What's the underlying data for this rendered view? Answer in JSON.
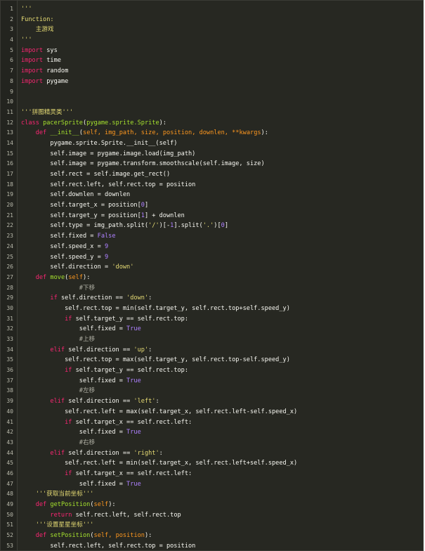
{
  "editor": {
    "colors": {
      "background": "#272822",
      "keyword": "#f92672",
      "function": "#a6e22e",
      "string": "#e6db74",
      "number": "#ae81ff",
      "parameter": "#fd971f",
      "text": "#f8f8f2"
    },
    "lines": [
      {
        "n": "1",
        "tokens": [
          [
            "str",
            "'''"
          ]
        ]
      },
      {
        "n": "2",
        "tokens": [
          [
            "str",
            "Function:"
          ]
        ]
      },
      {
        "n": "3",
        "tokens": [
          [
            "str",
            "    主游戏"
          ]
        ]
      },
      {
        "n": "4",
        "tokens": [
          [
            "str",
            "'''"
          ]
        ]
      },
      {
        "n": "5",
        "tokens": [
          [
            "kw",
            "import"
          ],
          [
            "txt",
            " sys"
          ]
        ]
      },
      {
        "n": "6",
        "tokens": [
          [
            "kw",
            "import"
          ],
          [
            "txt",
            " time"
          ]
        ]
      },
      {
        "n": "7",
        "tokens": [
          [
            "kw",
            "import"
          ],
          [
            "txt",
            " random"
          ]
        ]
      },
      {
        "n": "8",
        "tokens": [
          [
            "kw",
            "import"
          ],
          [
            "txt",
            " pygame"
          ]
        ]
      },
      {
        "n": "9",
        "tokens": []
      },
      {
        "n": "10",
        "tokens": []
      },
      {
        "n": "11",
        "tokens": [
          [
            "str",
            "'''拼图精灵类'''"
          ]
        ]
      },
      {
        "n": "12",
        "tokens": [
          [
            "kw",
            "class"
          ],
          [
            "txt",
            " "
          ],
          [
            "cls",
            "pacerSprite"
          ],
          [
            "txt",
            "("
          ],
          [
            "cls",
            "pygame.sprite.Sprite"
          ],
          [
            "txt",
            "):"
          ]
        ]
      },
      {
        "n": "13",
        "tokens": [
          [
            "txt",
            "    "
          ],
          [
            "kw",
            "def"
          ],
          [
            "txt",
            " "
          ],
          [
            "fn",
            "__init__"
          ],
          [
            "txt",
            "("
          ],
          [
            "param",
            "self, img_path, size, position, downlen, **kwargs"
          ],
          [
            "txt",
            "):"
          ]
        ]
      },
      {
        "n": "14",
        "tokens": [
          [
            "txt",
            "        pygame.sprite.Sprite.__init__(self)"
          ]
        ]
      },
      {
        "n": "15",
        "tokens": [
          [
            "txt",
            "        self.image = pygame.image.load(img_path)"
          ]
        ]
      },
      {
        "n": "16",
        "tokens": [
          [
            "txt",
            "        self.image = pygame.transform.smoothscale(self.image, size)"
          ]
        ]
      },
      {
        "n": "17",
        "tokens": [
          [
            "txt",
            "        self.rect = self.image.get_rect()"
          ]
        ]
      },
      {
        "n": "18",
        "tokens": [
          [
            "txt",
            "        self.rect.left, self.rect.top = position"
          ]
        ]
      },
      {
        "n": "19",
        "tokens": [
          [
            "txt",
            "        self.downlen = downlen"
          ]
        ]
      },
      {
        "n": "20",
        "tokens": [
          [
            "txt",
            "        self.target_x = position["
          ],
          [
            "num",
            "0"
          ],
          [
            "txt",
            "]"
          ]
        ]
      },
      {
        "n": "21",
        "tokens": [
          [
            "txt",
            "        self.target_y = position["
          ],
          [
            "num",
            "1"
          ],
          [
            "txt",
            "] + downlen"
          ]
        ]
      },
      {
        "n": "22",
        "tokens": [
          [
            "txt",
            "        self.type = img_path.split("
          ],
          [
            "str",
            "'/'"
          ],
          [
            "txt",
            ")[-"
          ],
          [
            "num",
            "1"
          ],
          [
            "txt",
            "].split("
          ],
          [
            "str",
            "'.'"
          ],
          [
            "txt",
            ")["
          ],
          [
            "num",
            "0"
          ],
          [
            "txt",
            "]"
          ]
        ]
      },
      {
        "n": "23",
        "tokens": [
          [
            "txt",
            "        self.fixed = "
          ],
          [
            "bool",
            "False"
          ]
        ]
      },
      {
        "n": "24",
        "tokens": [
          [
            "txt",
            "        self.speed_x = "
          ],
          [
            "num",
            "9"
          ]
        ]
      },
      {
        "n": "25",
        "tokens": [
          [
            "txt",
            "        self.speed_y = "
          ],
          [
            "num",
            "9"
          ]
        ]
      },
      {
        "n": "26",
        "tokens": [
          [
            "txt",
            "        self.direction = "
          ],
          [
            "str",
            "'down'"
          ]
        ]
      },
      {
        "n": "27",
        "tokens": [
          [
            "txt",
            "    "
          ],
          [
            "kw",
            "def"
          ],
          [
            "txt",
            " "
          ],
          [
            "fn",
            "move"
          ],
          [
            "txt",
            "("
          ],
          [
            "param",
            "self"
          ],
          [
            "txt",
            "):"
          ]
        ]
      },
      {
        "n": "28",
        "tokens": [
          [
            "com",
            "                #下移"
          ]
        ]
      },
      {
        "n": "29",
        "tokens": [
          [
            "txt",
            "        "
          ],
          [
            "kw",
            "if"
          ],
          [
            "txt",
            " self.direction == "
          ],
          [
            "str",
            "'down'"
          ],
          [
            "txt",
            ":"
          ]
        ]
      },
      {
        "n": "30",
        "tokens": [
          [
            "txt",
            "            self.rect.top = min(self.target_y, self.rect.top+self.speed_y)"
          ]
        ]
      },
      {
        "n": "31",
        "tokens": [
          [
            "txt",
            "            "
          ],
          [
            "kw",
            "if"
          ],
          [
            "txt",
            " self.target_y == self.rect.top:"
          ]
        ]
      },
      {
        "n": "32",
        "tokens": [
          [
            "txt",
            "                self.fixed = "
          ],
          [
            "bool",
            "True"
          ]
        ]
      },
      {
        "n": "33",
        "tokens": [
          [
            "com",
            "                #上移"
          ]
        ]
      },
      {
        "n": "34",
        "tokens": [
          [
            "txt",
            "        "
          ],
          [
            "kw",
            "elif"
          ],
          [
            "txt",
            " self.direction == "
          ],
          [
            "str",
            "'up'"
          ],
          [
            "txt",
            ":"
          ]
        ]
      },
      {
        "n": "35",
        "tokens": [
          [
            "txt",
            "            self.rect.top = max(self.target_y, self.rect.top-self.speed_y)"
          ]
        ]
      },
      {
        "n": "36",
        "tokens": [
          [
            "txt",
            "            "
          ],
          [
            "kw",
            "if"
          ],
          [
            "txt",
            " self.target_y == self.rect.top:"
          ]
        ]
      },
      {
        "n": "37",
        "tokens": [
          [
            "txt",
            "                self.fixed = "
          ],
          [
            "bool",
            "True"
          ]
        ]
      },
      {
        "n": "38",
        "tokens": [
          [
            "com",
            "                #左移"
          ]
        ]
      },
      {
        "n": "39",
        "tokens": [
          [
            "txt",
            "        "
          ],
          [
            "kw",
            "elif"
          ],
          [
            "txt",
            " self.direction == "
          ],
          [
            "str",
            "'left'"
          ],
          [
            "txt",
            ":"
          ]
        ]
      },
      {
        "n": "40",
        "tokens": [
          [
            "txt",
            "            self.rect.left = max(self.target_x, self.rect.left-self.speed_x)"
          ]
        ]
      },
      {
        "n": "41",
        "tokens": [
          [
            "txt",
            "            "
          ],
          [
            "kw",
            "if"
          ],
          [
            "txt",
            " self.target_x == self.rect.left:"
          ]
        ]
      },
      {
        "n": "42",
        "tokens": [
          [
            "txt",
            "                self.fixed = "
          ],
          [
            "bool",
            "True"
          ]
        ]
      },
      {
        "n": "43",
        "tokens": [
          [
            "com",
            "                #右移"
          ]
        ]
      },
      {
        "n": "44",
        "tokens": [
          [
            "txt",
            "        "
          ],
          [
            "kw",
            "elif"
          ],
          [
            "txt",
            " self.direction == "
          ],
          [
            "str",
            "'right'"
          ],
          [
            "txt",
            ":"
          ]
        ]
      },
      {
        "n": "45",
        "tokens": [
          [
            "txt",
            "            self.rect.left = min(self.target_x, self.rect.left+self.speed_x)"
          ]
        ]
      },
      {
        "n": "46",
        "tokens": [
          [
            "txt",
            "            "
          ],
          [
            "kw",
            "if"
          ],
          [
            "txt",
            " self.target_x == self.rect.left:"
          ]
        ]
      },
      {
        "n": "47",
        "tokens": [
          [
            "txt",
            "                self.fixed = "
          ],
          [
            "bool",
            "True"
          ]
        ]
      },
      {
        "n": "48",
        "tokens": [
          [
            "txt",
            "    "
          ],
          [
            "str",
            "'''获取当前坐标'''"
          ]
        ]
      },
      {
        "n": "49",
        "tokens": [
          [
            "txt",
            "    "
          ],
          [
            "kw",
            "def"
          ],
          [
            "txt",
            " "
          ],
          [
            "fn",
            "getPosition"
          ],
          [
            "txt",
            "("
          ],
          [
            "param",
            "self"
          ],
          [
            "txt",
            "):"
          ]
        ]
      },
      {
        "n": "50",
        "tokens": [
          [
            "txt",
            "        "
          ],
          [
            "kw",
            "return"
          ],
          [
            "txt",
            " self.rect.left, self.rect.top"
          ]
        ]
      },
      {
        "n": "51",
        "tokens": [
          [
            "txt",
            "    "
          ],
          [
            "str",
            "'''设置星星坐标'''"
          ]
        ]
      },
      {
        "n": "52",
        "tokens": [
          [
            "txt",
            "    "
          ],
          [
            "kw",
            "def"
          ],
          [
            "txt",
            " "
          ],
          [
            "fn",
            "setPosition"
          ],
          [
            "txt",
            "("
          ],
          [
            "param",
            "self, position"
          ],
          [
            "txt",
            "):"
          ]
        ]
      },
      {
        "n": "53",
        "tokens": [
          [
            "txt",
            "        self.rect.left, self.rect.top = position"
          ]
        ]
      }
    ]
  }
}
